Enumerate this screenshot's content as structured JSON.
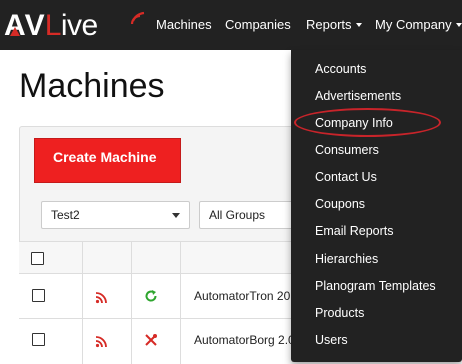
{
  "brand": {
    "logo_prefix": "AV",
    "logo_suffix": "Live",
    "accent_color": "#d62b26"
  },
  "navbar": {
    "machines_label": "Machines",
    "companies_label": "Companies",
    "reports_label": "Reports",
    "my_company_label": "My Company"
  },
  "page": {
    "title": "Machines",
    "create_button_label": "Create Machine",
    "company_select_value": "Test2",
    "group_select_value": "All Groups"
  },
  "table": {
    "rows": [
      {
        "name": "AutomatorTron 20",
        "status_icon": "rss-icon",
        "state_icon": "refresh-icon"
      },
      {
        "name": "AutomatorBorg 2.0",
        "status_icon": "rss-icon",
        "state_icon": "tools-icon"
      }
    ]
  },
  "reports_menu": {
    "items": [
      "Accounts",
      "Advertisements",
      "Company Info",
      "Consumers",
      "Contact Us",
      "Coupons",
      "Email Reports",
      "Hierarchies",
      "Planogram Templates",
      "Products",
      "Users"
    ],
    "highlighted_item": "Company Info",
    "highlight_color": "#c8242a"
  }
}
